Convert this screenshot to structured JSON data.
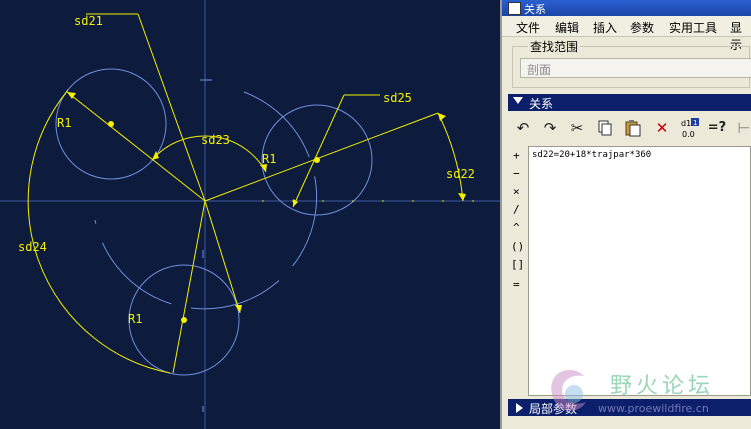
{
  "window": {
    "title": "关系"
  },
  "menu": {
    "items": [
      "文件",
      "编辑",
      "插入",
      "参数",
      "实用工具",
      "显示"
    ]
  },
  "search_scope": {
    "label": "查找范围",
    "value": "剖面"
  },
  "relations_section": {
    "label": "关系"
  },
  "toolbar": {
    "buttons": [
      "undo-icon",
      "redo-icon",
      "cut-icon",
      "copy-icon",
      "paste-icon",
      "delete-icon",
      "evaluate-icon",
      "verify-icon",
      "more-icon"
    ],
    "evaluate_top": "d1",
    "evaluate_badge": "1",
    "evaluate_bottom": "0.0",
    "verify_label": "=?"
  },
  "operators": [
    "+",
    "−",
    "×",
    "/",
    "^",
    "()",
    "[]",
    "="
  ],
  "editor": {
    "text": "sd22=20+18*trajpar*360"
  },
  "local_params": {
    "label": "局部参数"
  },
  "sketch": {
    "dims": {
      "sd21": "sd21",
      "sd23": "sd23",
      "sd24": "sd24",
      "sd25": "sd25",
      "sd22": "sd22",
      "r1": "R1",
      "r2": "R1",
      "r3": "R1"
    }
  },
  "watermark": {
    "title": "野火论坛",
    "url": "www.proewildfire.cn"
  },
  "colors": {
    "canvas": "#0d1b3c",
    "dimension": "#f4f000",
    "geometry": "#6f8fe0",
    "panel_bar": "#0c1f6b"
  }
}
